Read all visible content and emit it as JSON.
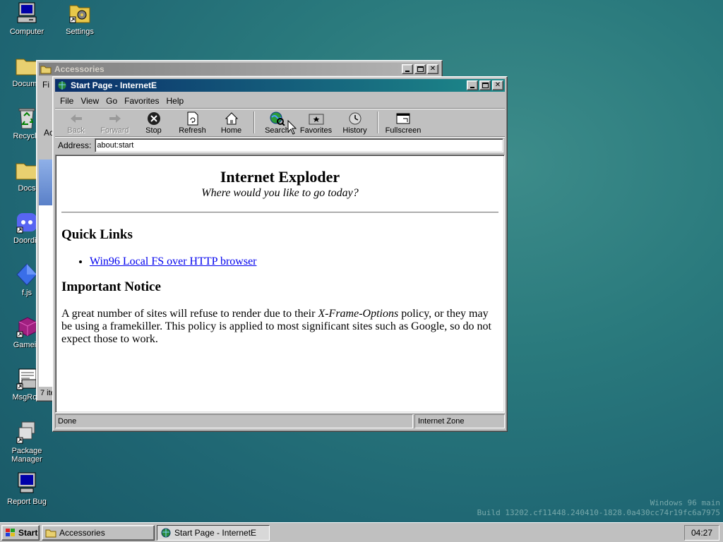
{
  "desktop": {
    "icons": [
      {
        "label": "Computer",
        "icon": "computer-icon"
      },
      {
        "label": "Settings",
        "icon": "settings-icon"
      },
      {
        "label": "Docume",
        "icon": "folder-icon"
      },
      {
        "label": "Recycle",
        "icon": "recycle-bin-icon"
      },
      {
        "label": "Docs",
        "icon": "folder-icon"
      },
      {
        "label": "Doordis",
        "icon": "discord-icon"
      },
      {
        "label": "f.js",
        "icon": "diamond-icon"
      },
      {
        "label": "Gamein",
        "icon": "game-icon"
      },
      {
        "label": "MsgRoo",
        "icon": "message-icon"
      },
      {
        "label": "Package Manager",
        "icon": "package-icon"
      },
      {
        "label": "Report Bug",
        "icon": "monitor-icon"
      }
    ],
    "watermark_line1": "Windows 96 main",
    "watermark_line2": "Build 13202.cf11448.240410-1828.0a430cc74r19fc6a7975"
  },
  "accessories_window": {
    "title": "Accessories",
    "menu_fragment": "Fi",
    "side_fragment": "Ac",
    "status_fragment": "7 ite"
  },
  "browser": {
    "title": "Start Page - InternetE",
    "menu": [
      "File",
      "View",
      "Go",
      "Favorites",
      "Help"
    ],
    "toolbar": {
      "back": "Back",
      "forward": "Forward",
      "stop": "Stop",
      "refresh": "Refresh",
      "home": "Home",
      "search": "Search",
      "favorites": "Favorites",
      "history": "History",
      "fullscreen": "Fullscreen"
    },
    "address_label": "Address:",
    "address_value": "about:start",
    "status_left": "Done",
    "status_right": "Internet Zone",
    "page": {
      "heading": "Internet Exploder",
      "tagline": "Where would you like to go today?",
      "quick_links_heading": "Quick Links",
      "quick_link_1": "Win96 Local FS over HTTP browser",
      "notice_heading": "Important Notice",
      "notice_part1": "A great number of sites will refuse to render due to their ",
      "notice_em": "X-Frame-Options",
      "notice_part2": " policy, or they may be using a framekiller. This policy is applied to most significant sites such as Google, so do not expect those to work."
    }
  },
  "taskbar": {
    "start_label": "Start",
    "items": [
      "Accessories",
      "Start Page - InternetE"
    ],
    "clock": "04:27"
  },
  "colors": {
    "desktop": "#2a7a7d",
    "title_active_start": "#0b2f6b",
    "title_active_end": "#1d8a8a",
    "face": "#c0c0c0",
    "link": "#0000ee"
  }
}
